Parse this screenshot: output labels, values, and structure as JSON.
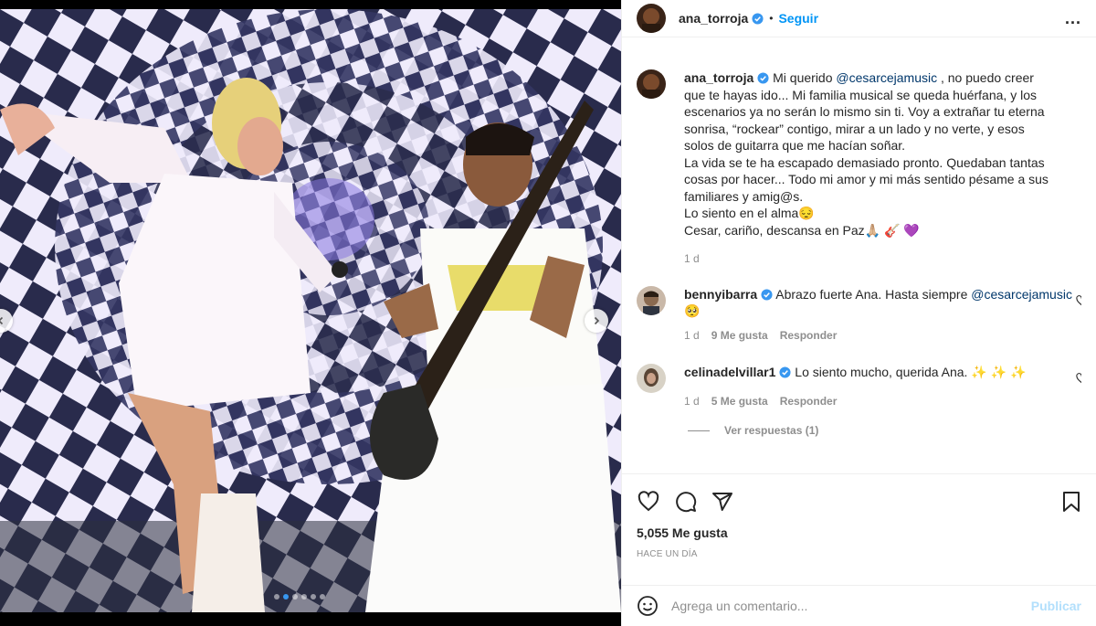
{
  "post": {
    "author": "ana_torroja",
    "follow_label": "Seguir",
    "bullet": "•",
    "more": "...",
    "caption": {
      "username": "ana_torroja",
      "text_before": "Mi querido ",
      "mention": "@cesarcejamusic",
      "text_after": " , no puedo creer que te hayas ido... Mi familia musical se queda huérfana, y los escenarios ya no serán lo mismo sin ti. Voy a extrañar tu eterna sonrisa, “rockear” contigo, mirar a un lado y no verte, y esos solos de guitarra que me hacían soñar.",
      "line2": "La vida se te ha escapado demasiado pronto. Quedaban tantas cosas por hacer... Todo mi amor y mi más sentido pésame a sus familiares y amig@s.",
      "line3": "Lo siento en el alma😔",
      "line4": "Cesar, cariño, descansa en Paz🙏🏼 🎸 💜",
      "time": "1 d"
    },
    "comments": [
      {
        "username": "bennyibarra",
        "text": "Abrazo fuerte Ana. Hasta siempre ",
        "mention": "@cesarcejamusic",
        "emoji": " 🥺",
        "time": "1 d",
        "likes": "9 Me gusta",
        "reply": "Responder"
      },
      {
        "username": "celinadelvillar1",
        "text": "Lo siento mucho, querida Ana. ✨ ✨ ✨",
        "time": "1 d",
        "likes": "5 Me gusta",
        "reply": "Responder"
      }
    ],
    "view_replies": "Ver respuestas (1)",
    "likes_count": "5,055 Me gusta",
    "posted_time": "HACE UN DÍA",
    "comment_placeholder": "Agrega un comentario...",
    "publish_label": "Publicar"
  },
  "colors": {
    "link": "#0095f6",
    "mention": "#00376b",
    "verified": "#3897f0",
    "muted": "#8e8e8e"
  }
}
